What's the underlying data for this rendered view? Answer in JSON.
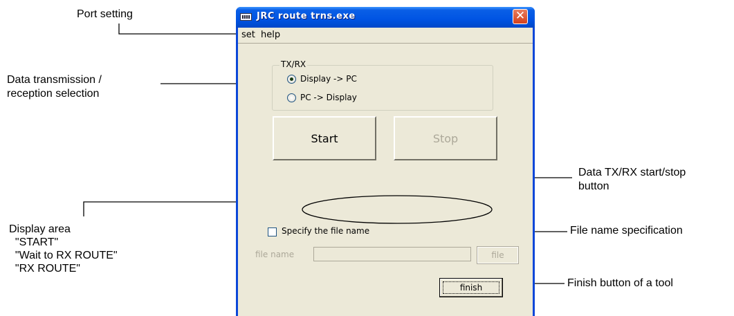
{
  "annotations": {
    "port_setting": "Port setting",
    "txrx_selection": "Data transmission /\nreception selection",
    "start_stop": "Data TX/RX start/stop\nbutton",
    "display_area": "Display area\n  \"START\"\n  \"Wait to RX ROUTE\"\n  \"RX ROUTE\"",
    "file_name_spec": "File name specification",
    "finish_button": "Finish button of a tool"
  },
  "window": {
    "title": "JRC route trns.exe",
    "close_glyph": "✕",
    "icon": "app-window-icon"
  },
  "menu": [
    "set",
    "help"
  ],
  "txrx_group": {
    "legend": "TX/RX",
    "options": [
      {
        "label": "Display -> PC",
        "selected": true
      },
      {
        "label": "PC -> Display",
        "selected": false
      }
    ]
  },
  "buttons": {
    "start": "Start",
    "stop": "Stop",
    "file": "file",
    "finish": "finish"
  },
  "file_spec": {
    "checkbox_label": "Specify the file name",
    "checked": false,
    "field_label": "file name",
    "field_value": ""
  },
  "colors": {
    "titlebar": "#0054e3",
    "client_bg": "#ece9d8",
    "disabled_text": "#aca899",
    "close_button": "#d5411c"
  }
}
